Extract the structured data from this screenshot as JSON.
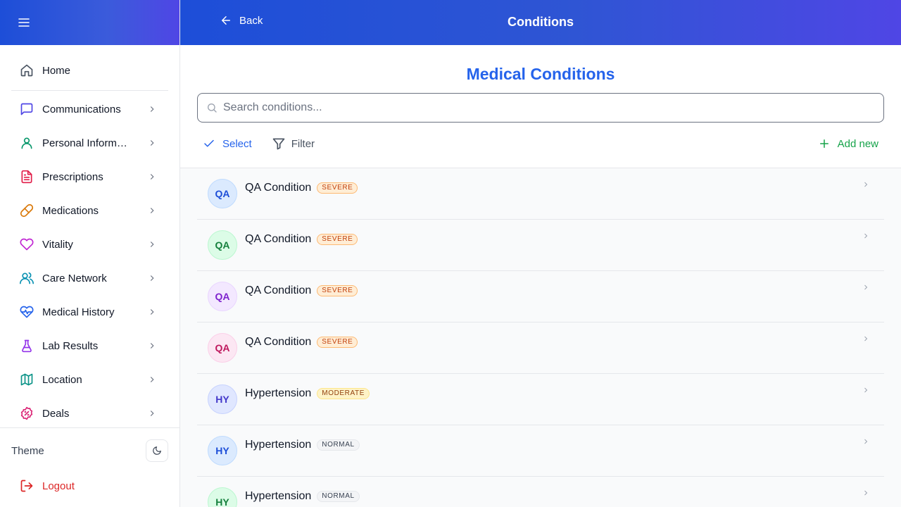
{
  "header": {
    "title": "Conditions",
    "back_label": "Back"
  },
  "sidebar": {
    "items": [
      {
        "label": "Home",
        "icon": "home-icon",
        "color": "#4b5563"
      },
      {
        "label": "Communications",
        "icon": "message-square-icon",
        "color": "#4f46e5"
      },
      {
        "label": "Personal Information",
        "icon": "user-icon",
        "color": "#059669"
      },
      {
        "label": "Prescriptions",
        "icon": "file-text-icon",
        "color": "#e11d48"
      },
      {
        "label": "Medications",
        "icon": "pill-icon",
        "color": "#d97706"
      },
      {
        "label": "Vitality",
        "icon": "heart-icon",
        "color": "#c026d3"
      },
      {
        "label": "Care Network",
        "icon": "users-icon",
        "color": "#0891b2"
      },
      {
        "label": "Medical History",
        "icon": "heart-pulse-icon",
        "color": "#2563eb"
      },
      {
        "label": "Lab Results",
        "icon": "flask-icon",
        "color": "#9333ea"
      },
      {
        "label": "Location",
        "icon": "map-icon",
        "color": "#0d9488"
      },
      {
        "label": "Deals",
        "icon": "badge-percent-icon",
        "color": "#db2777"
      }
    ],
    "theme_label": "Theme",
    "logout_label": "Logout"
  },
  "main": {
    "section_title": "Medical Conditions",
    "search_placeholder": "Search conditions...",
    "toolbar": {
      "select_label": "Select",
      "filter_label": "Filter",
      "add_label": "Add new"
    },
    "conditions": [
      {
        "initials": "QA",
        "name": "QA Condition",
        "severity": "SEVERE",
        "severity_kind": "severe",
        "avatar_bg": "#dbeafe",
        "avatar_fg": "#1d4ed8",
        "avatar_border": "#bfdbfe"
      },
      {
        "initials": "QA",
        "name": "QA Condition",
        "severity": "SEVERE",
        "severity_kind": "severe",
        "avatar_bg": "#dcfce7",
        "avatar_fg": "#15803d",
        "avatar_border": "#bbf7d0"
      },
      {
        "initials": "QA",
        "name": "QA Condition",
        "severity": "SEVERE",
        "severity_kind": "severe",
        "avatar_bg": "#f3e8ff",
        "avatar_fg": "#7e22ce",
        "avatar_border": "#e9d5ff"
      },
      {
        "initials": "QA",
        "name": "QA Condition",
        "severity": "SEVERE",
        "severity_kind": "severe",
        "avatar_bg": "#fce7f3",
        "avatar_fg": "#be185d",
        "avatar_border": "#fbcfe8"
      },
      {
        "initials": "HY",
        "name": "Hypertension",
        "severity": "MODERATE",
        "severity_kind": "moderate",
        "avatar_bg": "#e0e7ff",
        "avatar_fg": "#4338ca",
        "avatar_border": "#c7d2fe"
      },
      {
        "initials": "HY",
        "name": "Hypertension",
        "severity": "NORMAL",
        "severity_kind": "normal",
        "avatar_bg": "#dbeafe",
        "avatar_fg": "#1d4ed8",
        "avatar_border": "#bfdbfe"
      },
      {
        "initials": "HY",
        "name": "Hypertension",
        "severity": "NORMAL",
        "severity_kind": "normal",
        "avatar_bg": "#dcfce7",
        "avatar_fg": "#15803d",
        "avatar_border": "#bbf7d0"
      }
    ]
  },
  "colors": {
    "accent": "#2563eb",
    "add": "#16a34a",
    "logout": "#dc2626",
    "header_start": "#1d4ed8",
    "header_end": "#4f46e5"
  }
}
